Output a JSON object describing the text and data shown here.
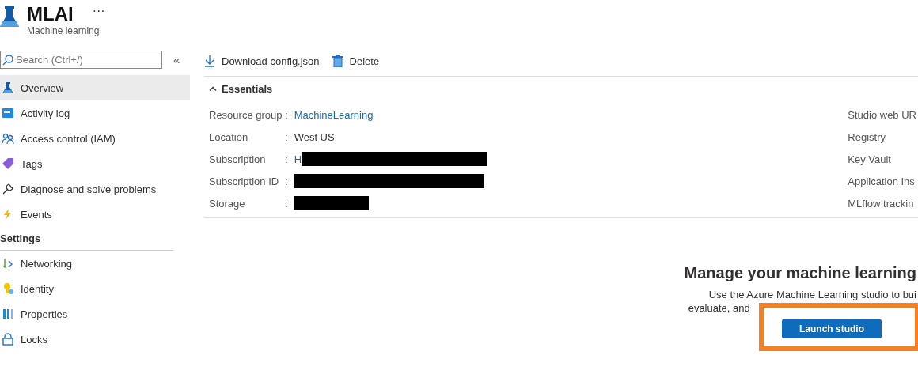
{
  "resource": {
    "title": "MLAI",
    "more": "···",
    "subtitle": "Machine learning"
  },
  "sidebar": {
    "search": {
      "placeholder": "Search (Ctrl+/)"
    },
    "collapse": "«",
    "items": [
      {
        "label": "Overview",
        "selected": true
      },
      {
        "label": "Activity log",
        "selected": false
      },
      {
        "label": "Access control (IAM)",
        "selected": false
      },
      {
        "label": "Tags",
        "selected": false
      },
      {
        "label": "Diagnose and solve problems",
        "selected": false
      },
      {
        "label": "Events",
        "selected": false
      }
    ],
    "sections": [
      {
        "title": "Settings",
        "items": [
          {
            "label": "Networking",
            "selected": false
          },
          {
            "label": "Identity",
            "selected": false
          },
          {
            "label": "Properties",
            "selected": false
          },
          {
            "label": "Locks",
            "selected": false
          }
        ]
      }
    ]
  },
  "toolbar": [
    {
      "label": "Download config.json"
    },
    {
      "label": "Delete"
    }
  ],
  "essentials": {
    "title": "Essentials",
    "expanded": true,
    "separator": ":",
    "left": [
      {
        "label": "Resource group",
        "value": "MachineLearning",
        "kind": "link",
        "redacted": false
      },
      {
        "label": "Location",
        "value": "West US",
        "kind": "text",
        "redacted": false
      },
      {
        "label": "Subscription",
        "value": "H",
        "kind": "link",
        "redacted": true
      },
      {
        "label": "Subscription ID",
        "redacted": true
      },
      {
        "label": "Storage",
        "redacted": true
      }
    ],
    "right": [
      {
        "label": "Studio web UR"
      },
      {
        "label": "Registry"
      },
      {
        "label": "Key Vault"
      },
      {
        "label": "Application Ins"
      },
      {
        "label": "MLflow trackin"
      }
    ]
  },
  "promo": {
    "heading": "Manage your machine learning",
    "lines": [
      "Use the Azure Machine Learning studio to bui",
      "evaluate, and"
    ],
    "button": "Launch studio",
    "highlighted": true
  }
}
